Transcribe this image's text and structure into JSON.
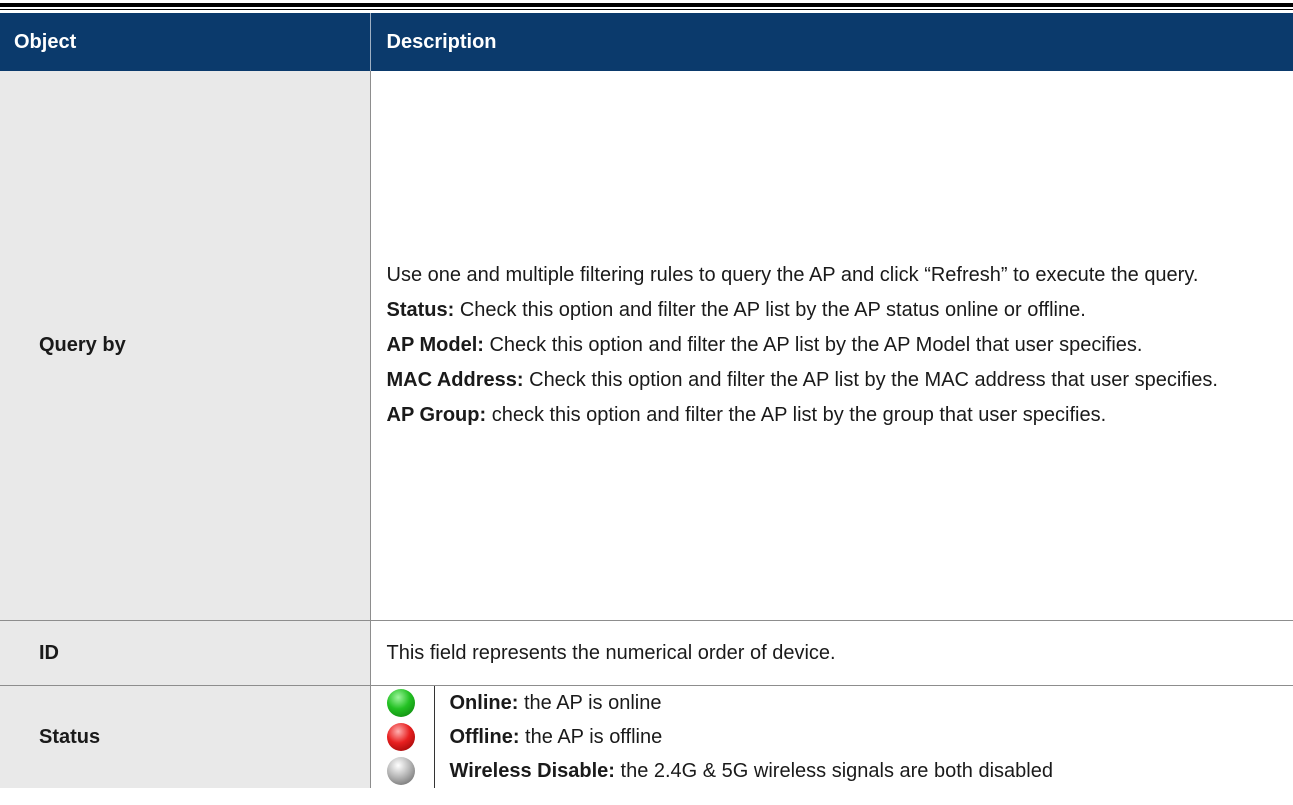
{
  "header": {
    "object": "Object",
    "description": "Description"
  },
  "rows": {
    "query": {
      "object": "Query by",
      "intro": "Use one and multiple filtering rules to query the AP and click “Refresh” to execute the query.",
      "items": [
        {
          "label": "Status:",
          "text": " Check this option and filter the AP list by the AP status online or offline."
        },
        {
          "label": "AP Model:",
          "text": " Check this option and filter the AP list by the AP Model that user specifies."
        },
        {
          "label": "MAC Address:",
          "text": " Check this option and filter the AP list by the MAC address that user specifies."
        },
        {
          "label": "AP Group:",
          "text": " check this option and filter the AP list by the group that user specifies."
        }
      ]
    },
    "id": {
      "object": "ID",
      "text": "This field represents the numerical order of device."
    },
    "status": {
      "object": "Status",
      "items": [
        {
          "icon": "green-status-icon",
          "color": "#23c123",
          "label": "Online:",
          "text": " the AP is online"
        },
        {
          "icon": "red-status-icon",
          "color": "#e82020",
          "label": "Offline:",
          "text": " the AP is offline"
        },
        {
          "icon": "grey-status-icon",
          "color": "#b8b8b8",
          "label": "Wireless Disable:",
          "text": " the 2.4G & 5G wireless signals are both disabled"
        }
      ]
    }
  }
}
